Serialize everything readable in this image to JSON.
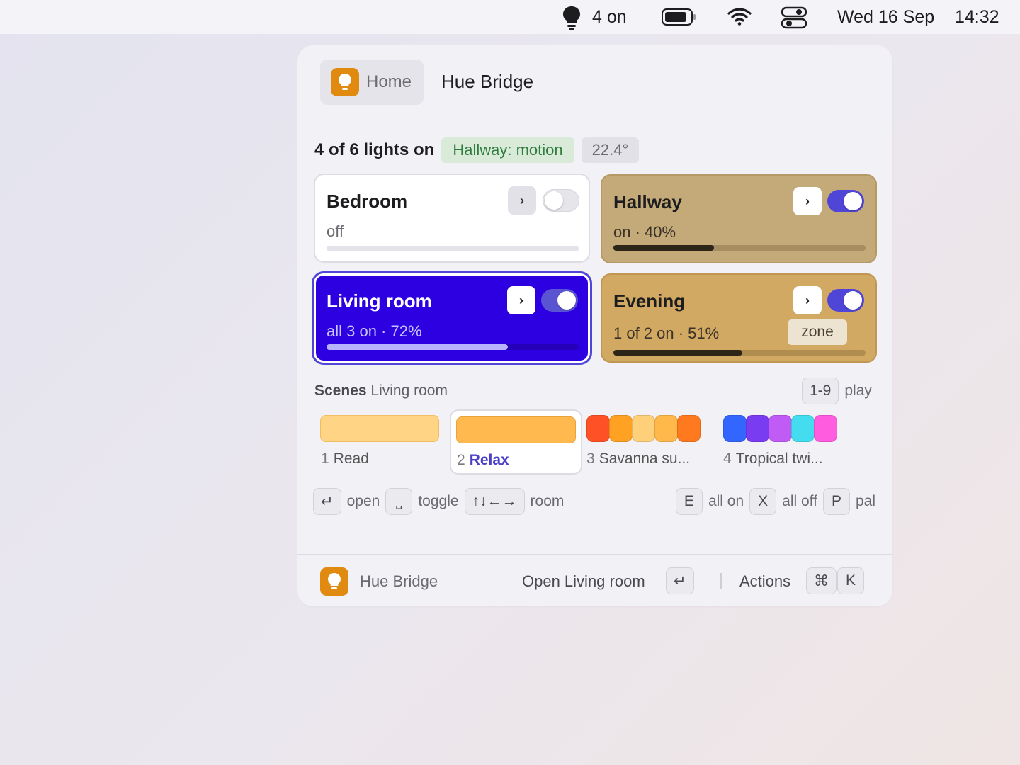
{
  "menubar": {
    "lights_count": "4 on",
    "date": "Wed 16 Sep",
    "time": "14:32",
    "icons": [
      "bulb-icon",
      "battery-icon",
      "wifi-icon",
      "control-center-icon"
    ]
  },
  "header": {
    "home_label": "Home",
    "title": "Hue Bridge",
    "icon": "bulb-icon"
  },
  "summary": {
    "text": "4 of 6 lights on",
    "motion_badge": "Hallway: motion",
    "temperature": "22.4°"
  },
  "rooms": [
    {
      "name": "Bedroom",
      "status": "off",
      "on": false,
      "brightness": 0
    },
    {
      "name": "Hallway",
      "status": "on · 40%",
      "on": true,
      "brightness": 40
    },
    {
      "name": "Living room",
      "status": "all 3 on · 72%",
      "on": true,
      "brightness": 72,
      "selected": true
    },
    {
      "name": "Evening",
      "status": "1 of 2 on · 51%",
      "on": true,
      "brightness": 51,
      "tag": "zone"
    }
  ],
  "scenes": {
    "label": "Scenes",
    "room": "Living room",
    "play_key": "1-9",
    "play_label": "play",
    "items": [
      {
        "num": "1",
        "name": "Read",
        "colors": [
          "#ffd485"
        ]
      },
      {
        "num": "2",
        "name": "Relax",
        "colors": [
          "#ffb94f"
        ],
        "active": true
      },
      {
        "num": "3",
        "name": "Savanna su...",
        "colors": [
          "#ff5126",
          "#ffa224",
          "#ffd07a",
          "#ffb84a",
          "#ff7a1f"
        ]
      },
      {
        "num": "4",
        "name": "Tropical twi...",
        "colors": [
          "#3366ff",
          "#7a3cf0",
          "#c05cf5",
          "#44ddf0",
          "#ff5ce0"
        ]
      }
    ]
  },
  "hints": {
    "left": [
      {
        "key": "↵",
        "label": "open"
      },
      {
        "key": "⎵",
        "label": "toggle"
      },
      {
        "key": "↑↓←→",
        "label": "room"
      }
    ],
    "right": [
      {
        "key": "E",
        "label": "all on"
      },
      {
        "key": "X",
        "label": "all off"
      },
      {
        "key": "P",
        "label": "pal"
      }
    ]
  },
  "footer": {
    "app_name": "Hue Bridge",
    "primary_action": "Open Living room",
    "primary_key": "↵",
    "actions_label": "Actions",
    "cmd_key": "⌘",
    "k_key": "K"
  },
  "colors": {
    "accent": "#4f46d8",
    "selected_card": "#2c00e0",
    "app_icon": "#e08a10"
  }
}
